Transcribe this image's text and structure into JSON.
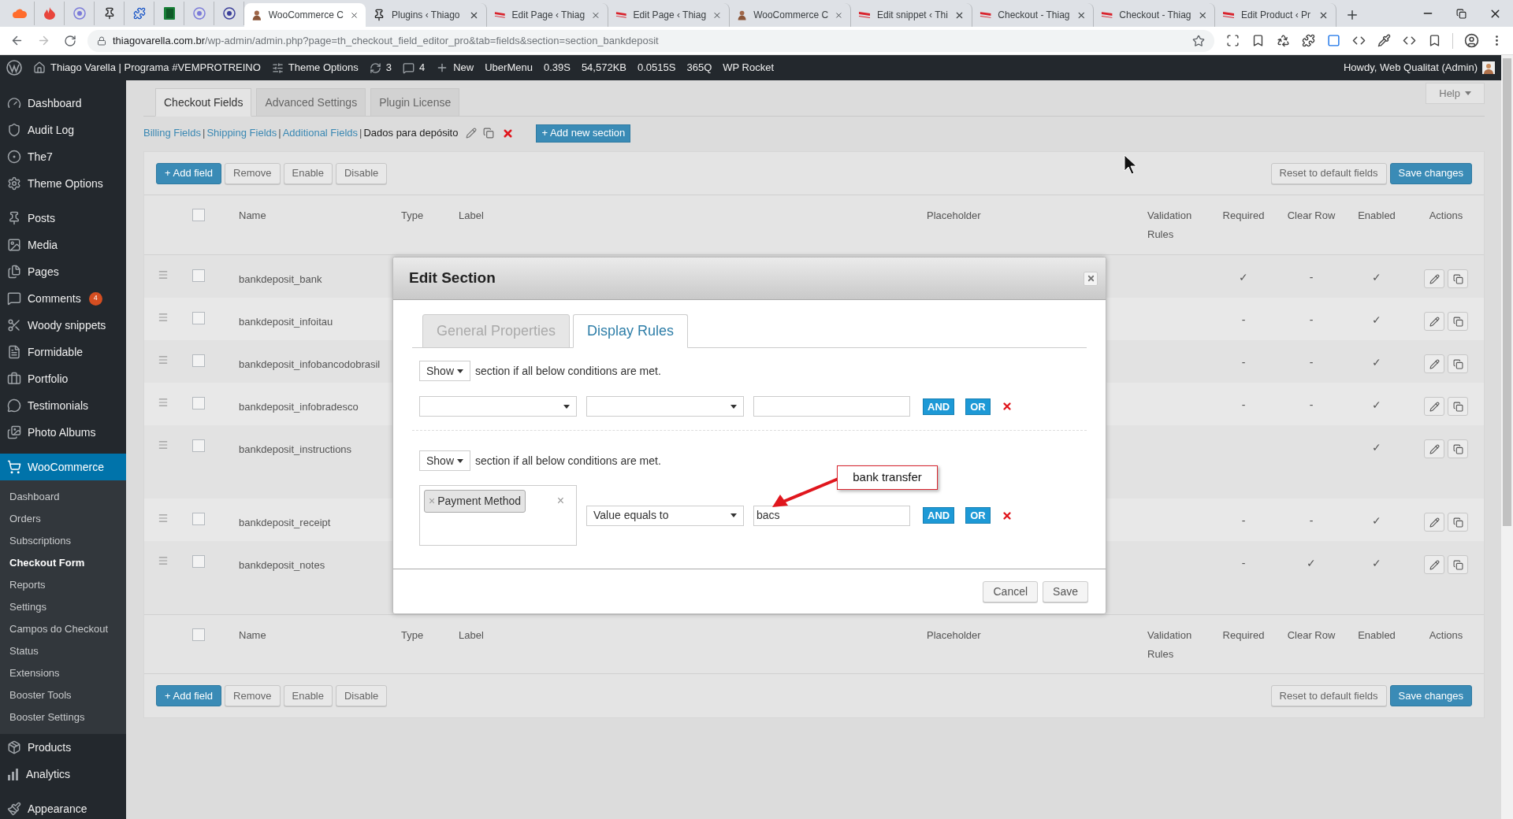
{
  "browser": {
    "tabs": [
      {
        "title": "WooCommerce C",
        "selected": true
      },
      {
        "title": "Plugins ‹ Thiago",
        "selected": false
      },
      {
        "title": "Edit Page ‹ Thiag",
        "selected": false
      },
      {
        "title": "Edit Page ‹ Thiag",
        "selected": false
      },
      {
        "title": "WooCommerce C",
        "selected": false
      },
      {
        "title": "Edit snippet ‹ Thi",
        "selected": false
      },
      {
        "title": "Checkout - Thiag",
        "selected": false
      },
      {
        "title": "Checkout - Thiag",
        "selected": false
      },
      {
        "title": "Edit Product ‹ Pr",
        "selected": false
      }
    ],
    "url_host": "thiagovarella.com.br",
    "url_path": "/wp-admin/admin.php?page=th_checkout_field_editor_pro&tab=fields&section=section_bankdeposit"
  },
  "admin_bar": {
    "site": "Thiago Varella | Programa #VEMPROTREINO",
    "theme_options": "Theme Options",
    "updates": "3",
    "comments": "4",
    "new": "New",
    "items": [
      "UberMenu",
      "0.39S",
      "54,572KB",
      "0.0515S",
      "365Q",
      "WP Rocket"
    ],
    "greeting": "Howdy, Web Qualitat (Admin)"
  },
  "sidebar": {
    "groups": [
      {
        "items": [
          {
            "label": "Dashboard",
            "selected": false
          },
          {
            "label": "Audit Log",
            "selected": false
          },
          {
            "label": "The7",
            "selected": false
          },
          {
            "label": "Theme Options",
            "selected": false
          }
        ]
      },
      {
        "items": [
          {
            "label": "Posts",
            "selected": false
          },
          {
            "label": "Media",
            "selected": false
          },
          {
            "label": "Pages",
            "selected": false
          },
          {
            "label": "Comments",
            "selected": false,
            "badge": "4"
          },
          {
            "label": "Woody snippets",
            "selected": false
          },
          {
            "label": "Formidable",
            "selected": false
          },
          {
            "label": "Portfolio",
            "selected": false
          },
          {
            "label": "Testimonials",
            "selected": false
          },
          {
            "label": "Photo Albums",
            "selected": false
          }
        ]
      },
      {
        "items": [
          {
            "label": "WooCommerce",
            "selected": true,
            "children": [
              {
                "label": "Dashboard",
                "selected": false
              },
              {
                "label": "Orders",
                "selected": false
              },
              {
                "label": "Subscriptions",
                "selected": false
              },
              {
                "label": "Checkout Form",
                "selected": true
              },
              {
                "label": "Reports",
                "selected": false
              },
              {
                "label": "Settings",
                "selected": false
              },
              {
                "label": "Campos do Checkout",
                "selected": false
              },
              {
                "label": "Status",
                "selected": false
              },
              {
                "label": "Extensions",
                "selected": false
              },
              {
                "label": "Booster Tools",
                "selected": false
              },
              {
                "label": "Booster Settings",
                "selected": false
              }
            ]
          },
          {
            "label": "Products",
            "selected": false
          },
          {
            "label": "Analytics",
            "selected": false
          }
        ]
      },
      {
        "items": [
          {
            "label": "Appearance",
            "selected": false
          }
        ]
      }
    ]
  },
  "page_tabs": [
    {
      "label": "Checkout Fields",
      "selected": true
    },
    {
      "label": "Advanced Settings",
      "selected": false
    },
    {
      "label": "Plugin License",
      "selected": false
    }
  ],
  "help": "Help",
  "sections": {
    "separator": "|",
    "items": [
      {
        "label": "Billing Fields",
        "selected": false
      },
      {
        "label": "Shipping Fields",
        "selected": false
      },
      {
        "label": "Additional Fields",
        "selected": false
      },
      {
        "label": "Dados para depósito",
        "selected": true
      }
    ],
    "add_button": "+ Add new section"
  },
  "toolbar_top": {
    "left": [
      {
        "label": "+ Add field",
        "kind": "primary"
      },
      {
        "label": "Remove",
        "kind": "secondary"
      },
      {
        "label": "Enable",
        "kind": "secondary"
      },
      {
        "label": "Disable",
        "kind": "secondary"
      }
    ],
    "right": [
      {
        "label": "Reset to default fields",
        "kind": "secondary"
      },
      {
        "label": "Save changes",
        "kind": "primary"
      }
    ]
  },
  "table": {
    "select_all_checked": false,
    "columns": [
      "Name",
      "Type",
      "Label",
      "Placeholder",
      "Validation Rules",
      "Required",
      "Clear Row",
      "Enabled",
      "Actions"
    ],
    "rows": [
      {
        "name": "bankdeposit_bank",
        "kind": "text",
        "checked": false,
        "required": "✓",
        "clear_row": "-",
        "enabled": "✓"
      },
      {
        "name": "bankdeposit_infoitau",
        "kind": "text",
        "checked": false,
        "required": "-",
        "clear_row": "-",
        "enabled": "✓"
      },
      {
        "name": "bankdeposit_infobancodobrasil",
        "kind": "text",
        "checked": false,
        "required": "-",
        "clear_row": "-",
        "enabled": "✓"
      },
      {
        "name": "bankdeposit_infobradesco",
        "kind": "text",
        "checked": false,
        "required": "-",
        "clear_row": "-",
        "enabled": "✓"
      },
      {
        "name": "bankdeposit_instructions",
        "kind": "textarea",
        "checked": false,
        "enabled": "✓"
      },
      {
        "name": "bankdeposit_receipt",
        "kind": "text",
        "checked": false,
        "required": "-",
        "clear_row": "-",
        "enabled": "✓"
      },
      {
        "name": "bankdeposit_notes",
        "kind": "textarea",
        "checked": false,
        "required": "-",
        "clear_row": "✓",
        "enabled": "✓"
      }
    ],
    "footer_select_all_checked": false,
    "footer_columns": [
      "Name",
      "Type",
      "Label",
      "Placeholder",
      "Validation Rules",
      "Required",
      "Clear Row",
      "Enabled",
      "Actions"
    ]
  },
  "toolbar_bottom": {
    "left": [
      {
        "label": "+ Add field",
        "kind": "primary"
      },
      {
        "label": "Remove",
        "kind": "secondary"
      },
      {
        "label": "Enable",
        "kind": "secondary"
      },
      {
        "label": "Disable",
        "kind": "secondary"
      }
    ],
    "right": [
      {
        "label": "Reset to default fields",
        "kind": "secondary"
      },
      {
        "label": "Save changes",
        "kind": "primary"
      }
    ]
  },
  "modal": {
    "title": "Edit Section",
    "tabs": [
      {
        "label": "General Properties",
        "selected": false
      },
      {
        "label": "Display Rules",
        "selected": true
      }
    ],
    "groups": [
      {
        "action": "Show",
        "text": "section if all below conditions are met.",
        "conditions": [
          {
            "and": "AND",
            "or": "OR"
          }
        ]
      },
      {
        "action": "Show",
        "text": "section if all below conditions are met.",
        "conditions": [
          {
            "tags": [
              {
                "label": "Payment Method",
                "remove": "×"
              }
            ],
            "clear": "×",
            "operator": "Value equals to",
            "value": "bacs",
            "and": "AND",
            "or": "OR"
          }
        ]
      }
    ],
    "buttons": [
      {
        "label": "Cancel"
      },
      {
        "label": "Save"
      }
    ]
  },
  "annotation": {
    "text": "bank transfer"
  }
}
